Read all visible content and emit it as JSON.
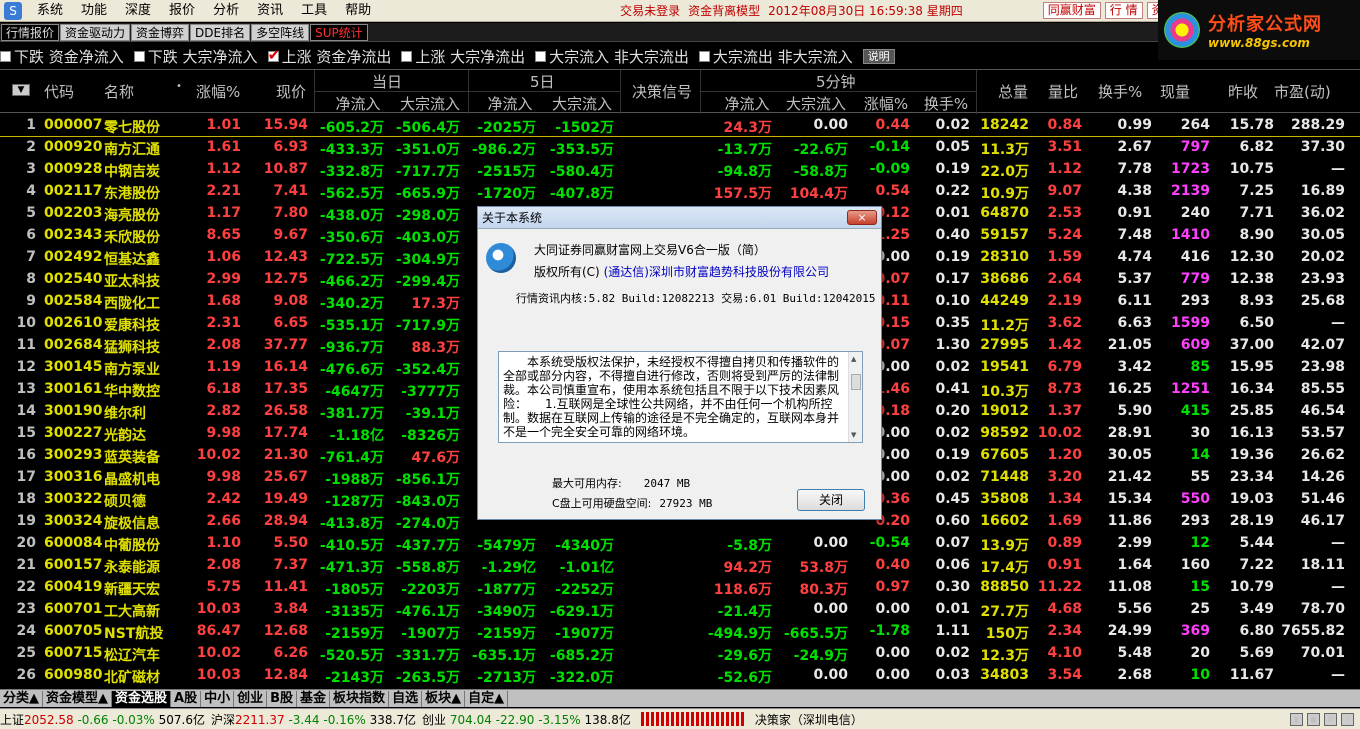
{
  "menu": {
    "items": [
      "系统",
      "功能",
      "深度",
      "报价",
      "分析",
      "资讯",
      "工具",
      "帮助"
    ],
    "status": "交易未登录",
    "model": "资金背离模型",
    "datetime": "2012年08月30日  16:59:38  星期四",
    "btn_tonghuan": "同赢财富",
    "btn_quote": "行 情",
    "btn_zi": "资"
  },
  "logo": {
    "title": "分析家公式网",
    "url": "www.88gs.com"
  },
  "tabs": [
    "行情报价",
    "资金驱动力",
    "资金博弈",
    "DDE排名",
    "多空阵线",
    "SUP统计"
  ],
  "filters": [
    {
      "label": "下跌 资金净流入",
      "checked": false
    },
    {
      "label": "下跌 大宗净流入",
      "checked": false
    },
    {
      "label": "上涨 资金净流出",
      "checked": true
    },
    {
      "label": "上涨 大宗净流出",
      "checked": false
    },
    {
      "label": "大宗流入 非大宗流出",
      "checked": false
    },
    {
      "label": "大宗流出 非大宗流入",
      "checked": false
    }
  ],
  "explain": "说明",
  "header": {
    "code": "代码",
    "name": "名称",
    "chg": "涨幅%",
    "price": "现价",
    "today": "当日",
    "five": "5日",
    "signal": "决策信号",
    "min5": "5分钟",
    "vol": "总量",
    "lb": "量比",
    "hs": "换手%",
    "xl": "现量",
    "zs": "昨收",
    "sy": "市盈(动)",
    "net": "净流入",
    "bulk": "大宗流入",
    "chg2": "涨幅%",
    "hs2": "换手%"
  },
  "rows": [
    [
      "1",
      "000007",
      "零七股份",
      "1.01",
      "15.94",
      "-605.2万",
      "-506.4万",
      "-2025万",
      "-1502万",
      "24.3万",
      "0.00",
      "0.44",
      "0.02",
      "18242",
      "0.84",
      "0.99",
      "264",
      "15.78",
      "288.29"
    ],
    [
      "2",
      "000920",
      "南方汇通",
      "1.61",
      "6.93",
      "-433.3万",
      "-351.0万",
      "-986.2万",
      "-353.5万",
      "-13.7万",
      "-22.6万",
      "-0.14",
      "0.05",
      "11.3万",
      "3.51",
      "2.67",
      "797",
      "6.82",
      "37.30"
    ],
    [
      "3",
      "000928",
      "中钢吉炭",
      "1.12",
      "10.87",
      "-332.8万",
      "-717.7万",
      "-2515万",
      "-580.4万",
      "-94.8万",
      "-58.8万",
      "-0.09",
      "0.19",
      "22.0万",
      "1.12",
      "7.78",
      "1723",
      "10.75",
      "—"
    ],
    [
      "4",
      "002117",
      "东港股份",
      "2.21",
      "7.41",
      "-562.5万",
      "-665.9万",
      "-1720万",
      "-407.8万",
      "157.5万",
      "104.4万",
      "0.54",
      "0.22",
      "10.9万",
      "9.07",
      "4.38",
      "2139",
      "7.25",
      "16.89"
    ],
    [
      "5",
      "002203",
      "海亮股份",
      "1.17",
      "7.80",
      "-438.0万",
      "-298.0万",
      "",
      "",
      "",
      "",
      "0.12",
      "0.01",
      "64870",
      "2.53",
      "0.91",
      "240",
      "7.71",
      "36.02"
    ],
    [
      "6",
      "002343",
      "禾欣股份",
      "8.65",
      "9.67",
      "-350.6万",
      "-403.0万",
      "",
      "",
      "",
      "",
      "1.25",
      "0.40",
      "59157",
      "5.24",
      "7.48",
      "1410",
      "8.90",
      "30.05"
    ],
    [
      "7",
      "002492",
      "恒基达鑫",
      "1.06",
      "12.43",
      "-722.5万",
      "-304.9万",
      "",
      "",
      "",
      "",
      "0.00",
      "0.19",
      "28310",
      "1.59",
      "4.74",
      "416",
      "12.30",
      "20.02"
    ],
    [
      "8",
      "002540",
      "亚太科技",
      "2.99",
      "12.75",
      "-466.2万",
      "-299.4万",
      "",
      "",
      "",
      "",
      "0.07",
      "0.17",
      "38686",
      "2.64",
      "5.37",
      "779",
      "12.38",
      "23.93"
    ],
    [
      "9",
      "002584",
      "西陇化工",
      "1.68",
      "9.08",
      "-340.2万",
      "17.3万",
      "",
      "",
      "",
      "",
      "0.11",
      "0.10",
      "44249",
      "2.19",
      "6.11",
      "293",
      "8.93",
      "25.68"
    ],
    [
      "10",
      "002610",
      "爱康科技",
      "2.31",
      "6.65",
      "-535.1万",
      "-717.9万",
      "",
      "",
      "",
      "",
      "0.15",
      "0.35",
      "11.2万",
      "3.62",
      "6.63",
      "1599",
      "6.50",
      "—"
    ],
    [
      "11",
      "002684",
      "猛狮科技",
      "2.08",
      "37.77",
      "-936.7万",
      "88.3万",
      "",
      "",
      "",
      "",
      "0.07",
      "1.30",
      "27995",
      "1.42",
      "21.05",
      "609",
      "37.00",
      "42.07"
    ],
    [
      "12",
      "300145",
      "南方泵业",
      "1.19",
      "16.14",
      "-476.6万",
      "-352.4万",
      "",
      "",
      "",
      "",
      "0.00",
      "0.02",
      "19541",
      "6.79",
      "3.42",
      "85",
      "15.95",
      "23.98"
    ],
    [
      "13",
      "300161",
      "华中数控",
      "6.18",
      "17.35",
      "-4647万",
      "-3777万",
      "",
      "",
      "",
      "",
      "1.46",
      "0.41",
      "10.3万",
      "8.73",
      "16.25",
      "1251",
      "16.34",
      "85.55"
    ],
    [
      "14",
      "300190",
      "维尔利",
      "2.82",
      "26.58",
      "-381.7万",
      "-39.1万",
      "",
      "",
      "",
      "",
      "0.18",
      "0.20",
      "19012",
      "1.37",
      "5.90",
      "415",
      "25.85",
      "46.54"
    ],
    [
      "15",
      "300227",
      "光韵达",
      "9.98",
      "17.74",
      "-1.18亿",
      "-8326万",
      "",
      "",
      "",
      "",
      "0.00",
      "0.02",
      "98592",
      "10.02",
      "28.91",
      "30",
      "16.13",
      "53.57"
    ],
    [
      "16",
      "300293",
      "蓝英装备",
      "10.02",
      "21.30",
      "-761.4万",
      "47.6万",
      "",
      "",
      "",
      "",
      "0.00",
      "0.19",
      "67605",
      "1.20",
      "30.05",
      "14",
      "19.36",
      "26.62"
    ],
    [
      "17",
      "300316",
      "晶盛机电",
      "9.98",
      "25.67",
      "-1988万",
      "-856.1万",
      "",
      "",
      "",
      "",
      "0.00",
      "0.02",
      "71448",
      "3.20",
      "21.42",
      "55",
      "23.34",
      "14.26"
    ],
    [
      "18",
      "300322",
      "硕贝德",
      "2.42",
      "19.49",
      "-1287万",
      "-843.0万",
      "",
      "",
      "",
      "",
      "0.36",
      "0.45",
      "35808",
      "1.34",
      "15.34",
      "550",
      "19.03",
      "51.46"
    ],
    [
      "19",
      "300324",
      "旋极信息",
      "2.66",
      "28.94",
      "-413.8万",
      "-274.0万",
      "",
      "",
      "",
      "",
      "0.20",
      "0.60",
      "16602",
      "1.69",
      "11.86",
      "293",
      "28.19",
      "46.17"
    ],
    [
      "20",
      "600084",
      "中葡股份",
      "1.10",
      "5.50",
      "-410.5万",
      "-437.7万",
      "-5479万",
      "-4340万",
      "-5.8万",
      "0.00",
      "-0.54",
      "0.07",
      "13.9万",
      "0.89",
      "2.99",
      "12",
      "5.44",
      "—"
    ],
    [
      "21",
      "600157",
      "永泰能源",
      "2.08",
      "7.37",
      "-471.3万",
      "-558.8万",
      "-1.29亿",
      "-1.01亿",
      "94.2万",
      "53.8万",
      "0.40",
      "0.06",
      "17.4万",
      "0.91",
      "1.64",
      "160",
      "7.22",
      "18.11"
    ],
    [
      "22",
      "600419",
      "新疆天宏",
      "5.75",
      "11.41",
      "-1805万",
      "-2203万",
      "-1877万",
      "-2252万",
      "118.6万",
      "80.3万",
      "0.97",
      "0.30",
      "88850",
      "11.22",
      "11.08",
      "15",
      "10.79",
      "—"
    ],
    [
      "23",
      "600701",
      "工大高新",
      "10.03",
      "3.84",
      "-3135万",
      "-476.1万",
      "-3490万",
      "-629.1万",
      "-21.4万",
      "0.00",
      "0.00",
      "0.01",
      "27.7万",
      "4.68",
      "5.56",
      "25",
      "3.49",
      "78.70"
    ],
    [
      "24",
      "600705",
      "NST航投",
      "86.47",
      "12.68",
      "-2159万",
      "-1907万",
      "-2159万",
      "-1907万",
      "-494.9万",
      "-665.5万",
      "-1.78",
      "1.11",
      "150万",
      "2.34",
      "24.99",
      "369",
      "6.80",
      "7655.82"
    ],
    [
      "25",
      "600715",
      "松辽汽车",
      "10.02",
      "6.26",
      "-520.5万",
      "-331.7万",
      "-635.1万",
      "-685.2万",
      "-29.6万",
      "-24.9万",
      "0.00",
      "0.02",
      "12.3万",
      "4.10",
      "5.48",
      "20",
      "5.69",
      "70.01"
    ],
    [
      "26",
      "600980",
      "北矿磁材",
      "10.03",
      "12.84",
      "-2143万",
      "-263.5万",
      "-2713万",
      "-322.0万",
      "-52.6万",
      "0.00",
      "0.00",
      "0.03",
      "34803",
      "3.54",
      "2.68",
      "10",
      "11.67",
      "—"
    ]
  ],
  "dialog": {
    "title": "关于本系统",
    "close": "×",
    "product": "大同证券同赢财富网上交易V6合一版（简）",
    "copyright_label": "版权所有(C)",
    "company": "(通达信)深圳市财富趋势科技股份有限公司",
    "version": "行情资讯内核:5.82 Build:12082213 交易:6.01 Build:12042015",
    "disclaimer": "　　本系统受版权法保护，未经授权不得擅自拷贝和传播软件的全部或部分内容，不得擅自进行修改，否则将受到严厉的法律制裁。本公司慎重宣布，使用本系统包括且不限于以下技术因素风险：　　1.互联网是全球性公共网络，并不由任何一个机构所控制。数据在互联网上传输的途径是不完全确定的，互联网本身并不是一个完全安全可靠的网络环境。",
    "mem_label": "最大可用内存:",
    "mem_value": "2047 MB",
    "disk_label": "C盘上可用硬盘空间:",
    "disk_value": "27923 MB",
    "btn": "关闭"
  },
  "bottom_tabs": [
    "分类▲",
    "资金模型▲",
    "资金选股",
    "A股",
    "中小",
    "创业",
    "B股",
    "基金",
    "板块指数",
    "自选",
    "板块▲",
    "自定▲"
  ],
  "statusbar": {
    "sh_label": "上证",
    "sh_val": "2052.58",
    "sh_chg": "-0.66",
    "sh_pct": "-0.03%",
    "sh_amt": "507.6亿",
    "sz_label": "沪深",
    "sz_val": "2211.37",
    "sz_chg": "-3.44",
    "sz_pct": "-0.16%",
    "sz_amt": "338.7亿",
    "cy_label": "创业",
    "cy_val": "704.04",
    "cy_chg": "-22.90",
    "cy_pct": "-3.15%",
    "cy_amt": "138.8亿",
    "decision": "决策家（深圳电信）"
  }
}
